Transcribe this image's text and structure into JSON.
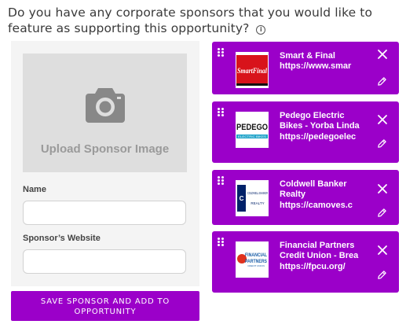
{
  "question": {
    "text": "Do you have any corporate sponsors that you would like to feature as supporting this opportunity?",
    "info_symbol": "i"
  },
  "form": {
    "upload_label": "Upload Sponsor Image",
    "name_label": "Name",
    "name_value": "",
    "website_label": "Sponsor’s Website",
    "website_value": "",
    "save_button_label": "SAVE SPONSOR AND ADD TO OPPORTUNITY"
  },
  "sponsors": [
    {
      "name": "Smart & Final",
      "url": "https://www.smar",
      "logo_text": "SmartFinal"
    },
    {
      "name": "Pedego Electric Bikes - Yorba Linda",
      "url": "https://pedegoelec",
      "logo_text": "PEDEGO",
      "logo_subtext": "ELECTRIC BIKES"
    },
    {
      "name": "Coldwell Banker Realty",
      "url": "https://camoves.c",
      "logo_text": "COLDWELL BANKER",
      "logo_subtext": "REALTY"
    },
    {
      "name": "Financial Partners Credit Union - Brea",
      "url": "https://fpcu.org/",
      "logo_text": "FINANCIAL",
      "logo_subtext": "PARTNERS",
      "logo_tiny": "CREDIT UNION"
    }
  ],
  "icons": {
    "drag": "drag-handle-icon",
    "close": "close-icon",
    "edit": "pencil-icon",
    "camera": "camera-icon",
    "info": "info-icon"
  },
  "colors": {
    "accent": "#9b00c9",
    "panel": "#f4f4f4",
    "upload_box": "#dedede"
  }
}
